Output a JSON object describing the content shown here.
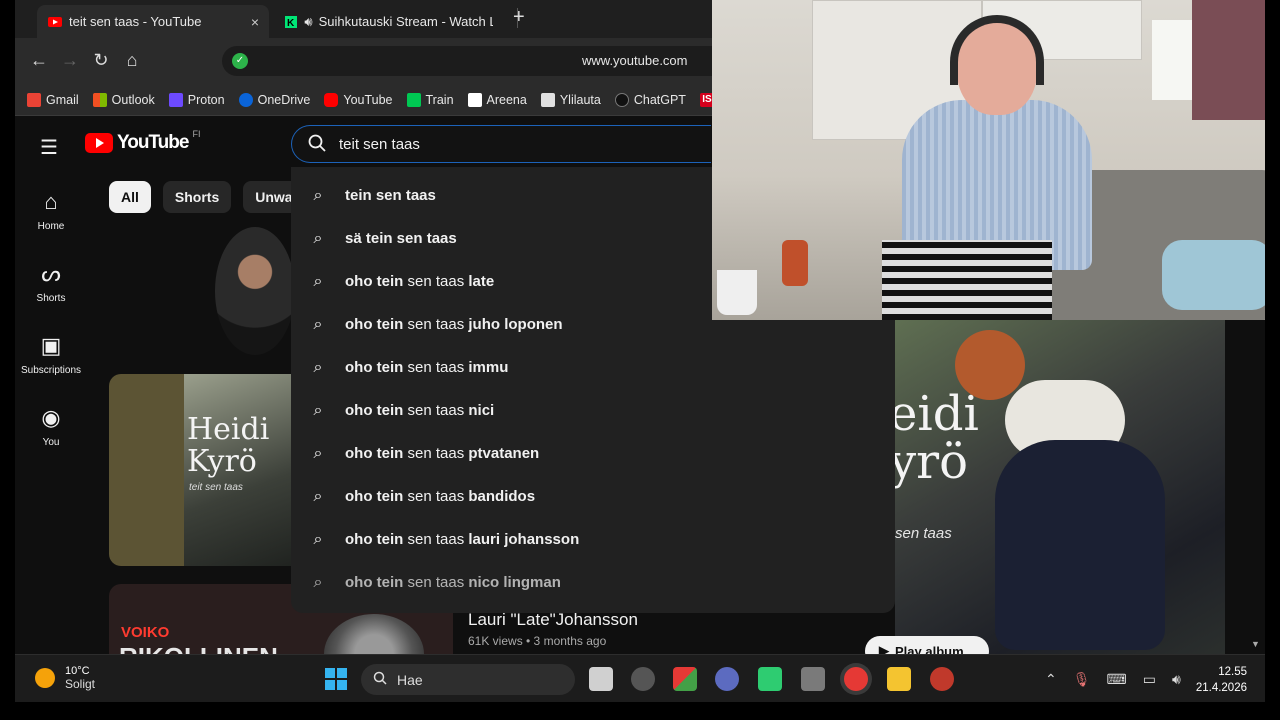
{
  "browser": {
    "tabs": [
      {
        "title": "teit sen taas - YouTube",
        "close": "×"
      },
      {
        "title": "Suihkutauski Stream - Watch Li"
      }
    ],
    "new_tab": "+",
    "url": "www.youtube.com",
    "bookmarks": [
      {
        "label": "Gmail",
        "color": "#ea4335"
      },
      {
        "label": "Outlook",
        "color": "#0078d4"
      },
      {
        "label": "Proton",
        "color": "#6d4aff"
      },
      {
        "label": "OneDrive",
        "color": "#0a64d8"
      },
      {
        "label": "YouTube",
        "color": "#ff0000"
      },
      {
        "label": "Train",
        "color": "#00c853"
      },
      {
        "label": "Areena",
        "color": "#ffffff"
      },
      {
        "label": "Ylilauta",
        "color": "#e0e0e0"
      },
      {
        "label": "ChatGPT",
        "color": "#1a1a1a"
      },
      {
        "label": "IS",
        "color": "#d4001c"
      }
    ]
  },
  "youtube": {
    "logo_text": "YouTube",
    "region": "FI",
    "search_value": "teit sen taas",
    "sidebar": [
      {
        "label": "Home",
        "icon": "home-icon"
      },
      {
        "label": "Shorts",
        "icon": "shorts-icon"
      },
      {
        "label": "Subscriptions",
        "icon": "subscriptions-icon"
      },
      {
        "label": "You",
        "icon": "you-icon"
      }
    ],
    "chips": [
      "All",
      "Shorts",
      "Unwatch"
    ],
    "suggestions": [
      {
        "bold": "tein sen taas",
        "rest": ""
      },
      {
        "bold": "sä tein sen taas",
        "rest": ""
      },
      {
        "bold": "oho tein",
        "rest": " sen taas ",
        "bold2": "late"
      },
      {
        "bold": "oho tein",
        "rest": " sen taas ",
        "bold2": "juho loponen"
      },
      {
        "bold": "oho tein",
        "rest": " sen taas ",
        "bold2": "immu"
      },
      {
        "bold": "oho tein",
        "rest": " sen taas ",
        "bold2": "nici"
      },
      {
        "bold": "oho tein",
        "rest": " sen taas ",
        "bold2": "ptvatanen"
      },
      {
        "bold": "oho tein",
        "rest": " sen taas ",
        "bold2": "bandidos"
      },
      {
        "bold": "oho tein",
        "rest": " sen taas ",
        "bold2": "lauri johansson"
      },
      {
        "bold": "oho tein",
        "rest": " sen taas ",
        "bold2": "nico lingman"
      }
    ],
    "album_left": {
      "title_line1": "Heidi",
      "title_line2": "Kyrö",
      "subtitle": "teit sen taas"
    },
    "album_right": {
      "title_line1": "eidi",
      "title_line2": "yrö",
      "subtitle": "sen taas",
      "play_label": "Play album"
    },
    "bottom_thumb": {
      "line1": "VOIKO",
      "line2": "RIKOLLINEN"
    },
    "video": {
      "title": "Lauri \"Late\"Johansson",
      "meta": "61K views • 3 months ago"
    }
  },
  "taskbar": {
    "weather_temp": "10°C",
    "weather_text": "Soligt",
    "search_placeholder": "Hae",
    "time": "12.55",
    "date": "21.4.2026"
  }
}
